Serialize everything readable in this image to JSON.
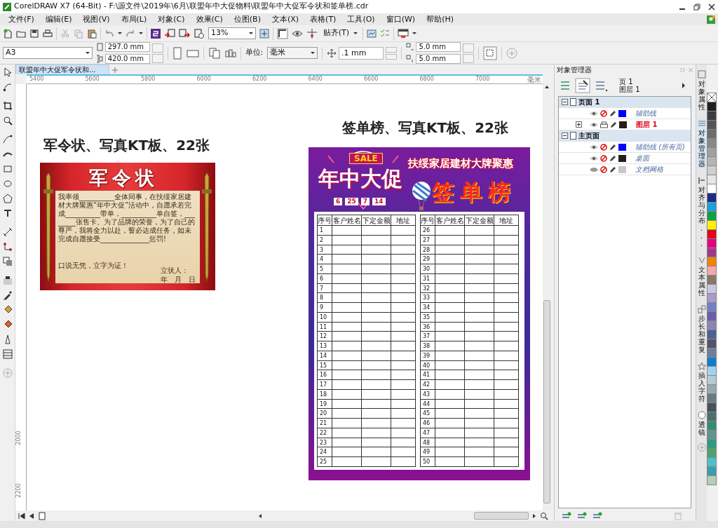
{
  "window": {
    "title": "CorelDRAW X7 (64-Bit) - F:\\源文件\\2019年\\6月\\联盟年中大促物料\\联盟年中大促军令状和签单榜.cdr"
  },
  "menu": [
    "文件(F)",
    "编辑(E)",
    "视图(V)",
    "布局(L)",
    "对象(C)",
    "效果(C)",
    "位图(B)",
    "文本(X)",
    "表格(T)",
    "工具(O)",
    "窗口(W)",
    "帮助(H)"
  ],
  "toolbar": {
    "zoom": "13%",
    "snap": "贴齐(T)"
  },
  "property_bar": {
    "page_size": "A3",
    "width": "297.0 mm",
    "height": "420.0 mm",
    "unit_label": "单位:",
    "unit": "毫米",
    "nudge": ".1 mm",
    "duplicate_x": "5.0 mm",
    "duplicate_y": "5.0 mm"
  },
  "document_tab": {
    "title": "联盟年中大促军令状和...",
    "selected": true
  },
  "ruler": {
    "horizontal": [
      "5400",
      "5600",
      "5800",
      "6000",
      "6200",
      "6400",
      "6600",
      "6800",
      "7000"
    ],
    "unit": "毫米",
    "vertical": [
      "2000",
      "2200"
    ]
  },
  "canvas": {
    "captions": [
      "军令状、写真KT板、22张",
      "签单榜、写真KT板、22张"
    ],
    "pledge": {
      "title": "军令状",
      "paragraph": "我率领__________全体同事，在扶绥家居建材大牌聚惠“年中大促”活动中，自愿承若完成__________带单，__________单自签，________张售卡。为了品牌的荣誉，为了自己的尊严，我将全力以赴，誓必达成任务，如未完成自愿接受______________惩罚!",
      "closing": "口说无凭，立字为证！",
      "signer": "立状人：",
      "date": "年　月　日"
    },
    "board": {
      "badge": "SALE",
      "event": "年中大促",
      "dates": [
        "6",
        "25",
        "7",
        "14"
      ],
      "headline": "扶绥家居建材大牌聚惠",
      "title": "签单榜",
      "tables": [
        {
          "columns": [
            "序号",
            "客户姓名",
            "下定金额",
            "地址"
          ],
          "rows": [
            "1",
            "2",
            "3",
            "4",
            "5",
            "6",
            "7",
            "8",
            "9",
            "10",
            "11",
            "12",
            "13",
            "14",
            "15",
            "16",
            "17",
            "18",
            "19",
            "20",
            "21",
            "22",
            "23",
            "24",
            "25"
          ]
        },
        {
          "columns": [
            "序号",
            "客户姓名",
            "下定金额",
            "地址"
          ],
          "rows": [
            "26",
            "27",
            "28",
            "29",
            "30",
            "31",
            "32",
            "33",
            "34",
            "35",
            "36",
            "37",
            "38",
            "39",
            "40",
            "41",
            "42",
            "43",
            "44",
            "45",
            "46",
            "47",
            "48",
            "49",
            "50"
          ]
        }
      ]
    }
  },
  "object_manager": {
    "title": "对象管理器",
    "page": "页 1",
    "layer": "图层 1",
    "tree": [
      {
        "name": "页面 1",
        "expanded": true,
        "children": [
          {
            "name": "辅助线",
            "color": "#0000ff",
            "visible": true,
            "printable": false,
            "active": false
          },
          {
            "name": "图层 1",
            "color": "#231f20",
            "visible": true,
            "printable": true,
            "active": true,
            "expanded": false
          }
        ]
      },
      {
        "name": "主页面",
        "expanded": true,
        "children": [
          {
            "name": "辅助线 (所有页)",
            "color": "#0000ff",
            "visible": true,
            "printable": false,
            "active": false
          },
          {
            "name": "桌面",
            "color": "#231f20",
            "visible": true,
            "printable": false,
            "active": false
          },
          {
            "name": "文档网格",
            "color": "#c8c8c8",
            "visible": false,
            "printable": false,
            "active": false
          }
        ]
      }
    ]
  },
  "docker_tabs": [
    {
      "label": "对象属性",
      "selected": false
    },
    {
      "label": "对象管理器",
      "selected": true
    },
    {
      "label": "对齐与分布...",
      "selected": false
    },
    {
      "label": "文本属性",
      "selected": false
    },
    {
      "label": "步长和重复",
      "selected": false
    },
    {
      "label": "插入字符",
      "selected": false
    },
    {
      "label": "透镜",
      "selected": false
    }
  ],
  "palette": [
    {
      "color": "#231f20"
    },
    {
      "color": "#3d3d3d"
    },
    {
      "color": "#555555"
    },
    {
      "color": "#6d6d6d"
    },
    {
      "color": "#888888"
    },
    {
      "color": "#a0a0a0"
    },
    {
      "color": "#b5b5b5"
    },
    {
      "color": "#cfcfcf"
    },
    {
      "color": "#e6e6e6"
    },
    {
      "color": "#ffffff"
    },
    {
      "color": "#1e2a87"
    },
    {
      "color": "#1aa0dd"
    },
    {
      "color": "#109e48"
    },
    {
      "color": "#fff200"
    },
    {
      "color": "#e3051b"
    },
    {
      "color": "#e4007f"
    },
    {
      "color": "#a5358e"
    },
    {
      "color": "#f08300"
    },
    {
      "color": "#f5a9ad"
    },
    {
      "color": "#8b7766"
    },
    {
      "color": "#cdc6e2"
    },
    {
      "color": "#a99bcc"
    },
    {
      "color": "#6f82c1"
    },
    {
      "color": "#6e5ea8"
    },
    {
      "color": "#8f83b4"
    },
    {
      "color": "#4a6295"
    },
    {
      "color": "#55526e"
    },
    {
      "color": "#6d7f9b"
    },
    {
      "color": "#0f7fc7"
    },
    {
      "color": "#9fd3f0"
    },
    {
      "color": "#b6cad6"
    },
    {
      "color": "#97a8b0"
    },
    {
      "color": "#6c7a83"
    },
    {
      "color": "#4a5158"
    },
    {
      "color": "#4d6f6b"
    },
    {
      "color": "#3a8a72"
    },
    {
      "color": "#62938c"
    },
    {
      "color": "#2f9b84"
    },
    {
      "color": "#48a46c"
    },
    {
      "color": "#4fbfc8"
    },
    {
      "color": "#3aa0a8"
    },
    {
      "color": "#b7cdb7"
    }
  ]
}
